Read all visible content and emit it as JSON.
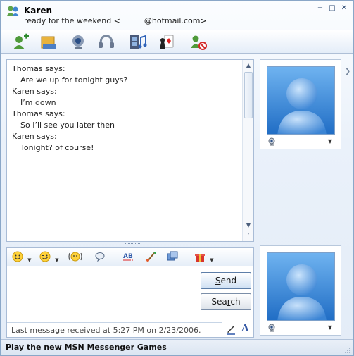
{
  "window": {
    "contact_name": "Karen",
    "status_before": "ready for the weekend <",
    "status_after": "@hotmail.com>",
    "controls": [
      "−",
      "□",
      "✕"
    ]
  },
  "toolbar": {
    "items": [
      "invite-contact",
      "send-files",
      "video-call",
      "voice-call",
      "activities",
      "games",
      "block-contact"
    ]
  },
  "conversation": {
    "messages": [
      {
        "sender": "Thomas says:",
        "text": "Are we up for tonight guys?"
      },
      {
        "sender": "Karen says:",
        "text": "I’m down"
      },
      {
        "sender": "Thomas says:",
        "text": "So I’ll see you later then"
      },
      {
        "sender": "Karen says:",
        "text": "Tonight? of course!"
      }
    ]
  },
  "compose": {
    "send_label_u": "S",
    "send_label_rest": "end",
    "search_label_pre": "Sea",
    "search_label_u": "r",
    "search_label_rest": "ch",
    "status_line": "Last message received at 5:27 PM on 2/23/2006.",
    "font_label": "A"
  },
  "footer": {
    "text": "Play the new MSN Messenger Games"
  },
  "colors": {
    "accent": "#3559a6",
    "border": "#a9bcd6",
    "avatar_blue": "#3a86d6"
  }
}
